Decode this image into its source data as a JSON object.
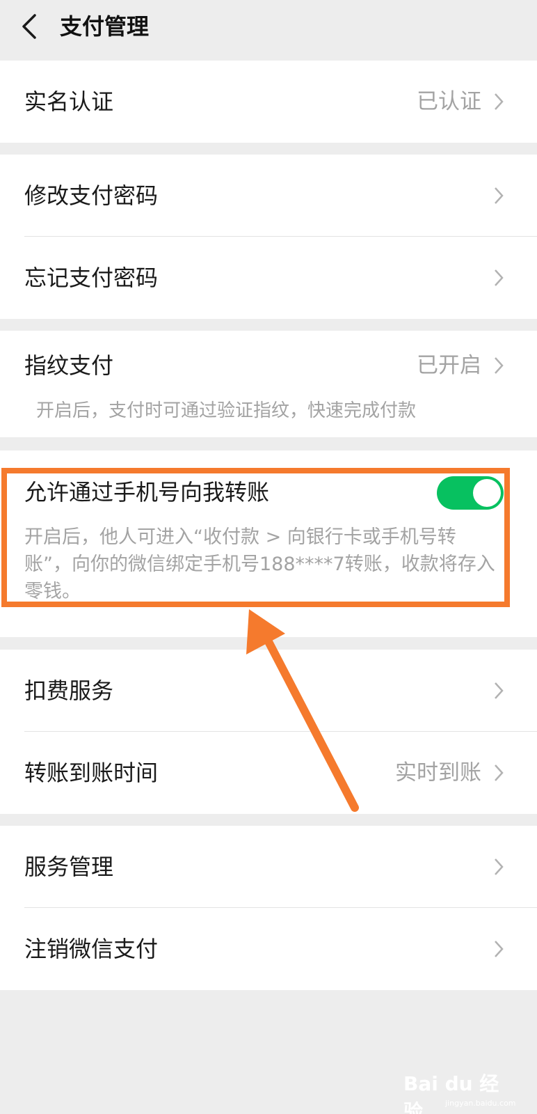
{
  "header": {
    "title": "支付管理"
  },
  "groups": {
    "verification": {
      "label": "实名认证",
      "value": "已认证"
    },
    "change_password": {
      "label": "修改支付密码"
    },
    "forgot_password": {
      "label": "忘记支付密码"
    },
    "fingerprint": {
      "label": "指纹支付",
      "value": "已开启",
      "desc": "开启后，支付时可通过验证指纹，快速完成付款"
    },
    "phone_transfer": {
      "label": "允许通过手机号向我转账",
      "enabled": true,
      "desc": "开启后，他人可进入“收付款 > 向银行卡或手机号转账”，向你的微信绑定手机号188****7转账，收款将存入零钱。"
    },
    "deduction": {
      "label": "扣费服务"
    },
    "arrival_time": {
      "label": "转账到账时间",
      "value": "实时到账"
    },
    "service_manage": {
      "label": "服务管理"
    },
    "cancel_pay": {
      "label": "注销微信支付"
    }
  },
  "watermark": {
    "text": "Bai du 经验",
    "sub": "jingyan.baidu.com"
  },
  "colors": {
    "toggle_on": "#07c160",
    "annotation": "#f57a2d",
    "background": "#ededed"
  },
  "icons": {
    "back": "back-arrow-icon",
    "chevron": "chevron-right-icon"
  }
}
